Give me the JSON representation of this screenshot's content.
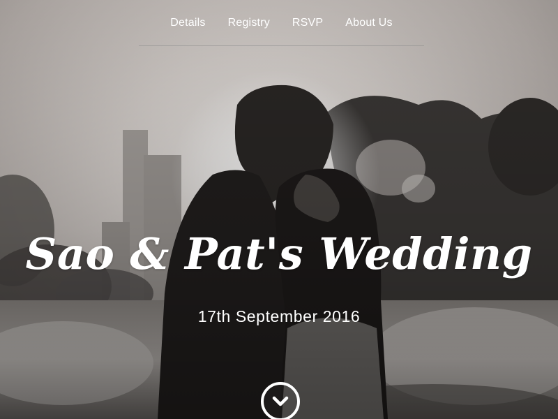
{
  "nav": {
    "items": [
      {
        "label": "Details"
      },
      {
        "label": "Registry"
      },
      {
        "label": "RSVP"
      },
      {
        "label": "About Us"
      }
    ]
  },
  "hero": {
    "title": "Sao & Pat's Wedding",
    "date": "17th September 2016",
    "scroll_icon": "chevron-down-circle-icon"
  },
  "colors": {
    "text": "#ffffff",
    "divider": "#8c8c8c"
  }
}
